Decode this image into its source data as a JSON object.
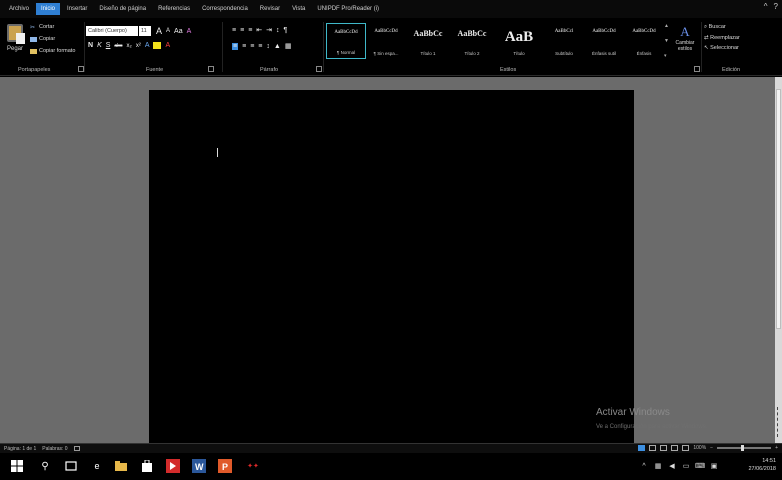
{
  "ribbon_tabs": [
    "Archivo",
    "Inicio",
    "Insertar",
    "Diseño de página",
    "Referencias",
    "Correspondencia",
    "Revisar",
    "Vista",
    "UNIPDF Pro/Reader (i)"
  ],
  "active_tab_index": 1,
  "window_controls": [
    "^",
    "?"
  ],
  "clipboard": {
    "paste_label": "Pegar",
    "cut_label": "Cortar",
    "copy_label": "Copiar",
    "format_painter_label": "Copiar formato",
    "group_label": "Portapapeles"
  },
  "font": {
    "font_name": "Calibri (Cuerpo)",
    "font_size": "11",
    "row1": [
      "A",
      "A",
      "Aa",
      "A"
    ],
    "row2": [
      "N",
      "K",
      "S",
      "abc",
      "x₂",
      "x²",
      "A",
      "A"
    ],
    "group_label": "Fuente"
  },
  "paragraph": {
    "row1": [
      "≡",
      "≡",
      "≡",
      "≣",
      "⇤",
      "⇥",
      "↕",
      "¶"
    ],
    "row2": [
      "≡",
      "≡",
      "≡",
      "≡",
      "↕",
      "▲",
      "▦"
    ],
    "group_label": "Párrafo"
  },
  "styles": {
    "items": [
      {
        "preview": "AaBbCcDd",
        "name": "¶ Normal",
        "size": 5
      },
      {
        "preview": "AaBbCcDd",
        "name": "¶ Sin espa...",
        "size": 5
      },
      {
        "preview": "AaBbCc",
        "name": "Título 1",
        "size": 8
      },
      {
        "preview": "AaBbCc",
        "name": "Título 2",
        "size": 8
      },
      {
        "preview": "AaB",
        "name": "Título",
        "size": 15
      },
      {
        "preview": "AaBbCcl",
        "name": "Subtítulo",
        "size": 5
      },
      {
        "preview": "AaBbCcDd",
        "name": "Énfasis sutil",
        "size": 5
      },
      {
        "preview": "AaBbCcDd",
        "name": "Énfasis",
        "size": 5
      }
    ],
    "selected_index": 0,
    "group_label": "Estilos"
  },
  "change_styles": {
    "label": "Cambiar estilos",
    "glyph": "A"
  },
  "editing": {
    "find_label": "Buscar",
    "replace_label": "Reemplazar",
    "select_label": "Seleccionar",
    "group_label": "Edición"
  },
  "watermark": {
    "title": "Activar Windows",
    "subtitle": "Ve a Configuración para activar Windows."
  },
  "status_bar": {
    "page": "Página: 1 de 1",
    "words": "Palabras: 0",
    "zoom": "100%"
  },
  "taskbar": {
    "time": "14:51",
    "date": "27/06/2018"
  },
  "colors": {
    "active_tab": "#2f7fd3",
    "workspace": "#6b6b6b",
    "page": "#000000",
    "word_blue": "#2b579a",
    "accent_cyan": "#3fb8c9"
  }
}
